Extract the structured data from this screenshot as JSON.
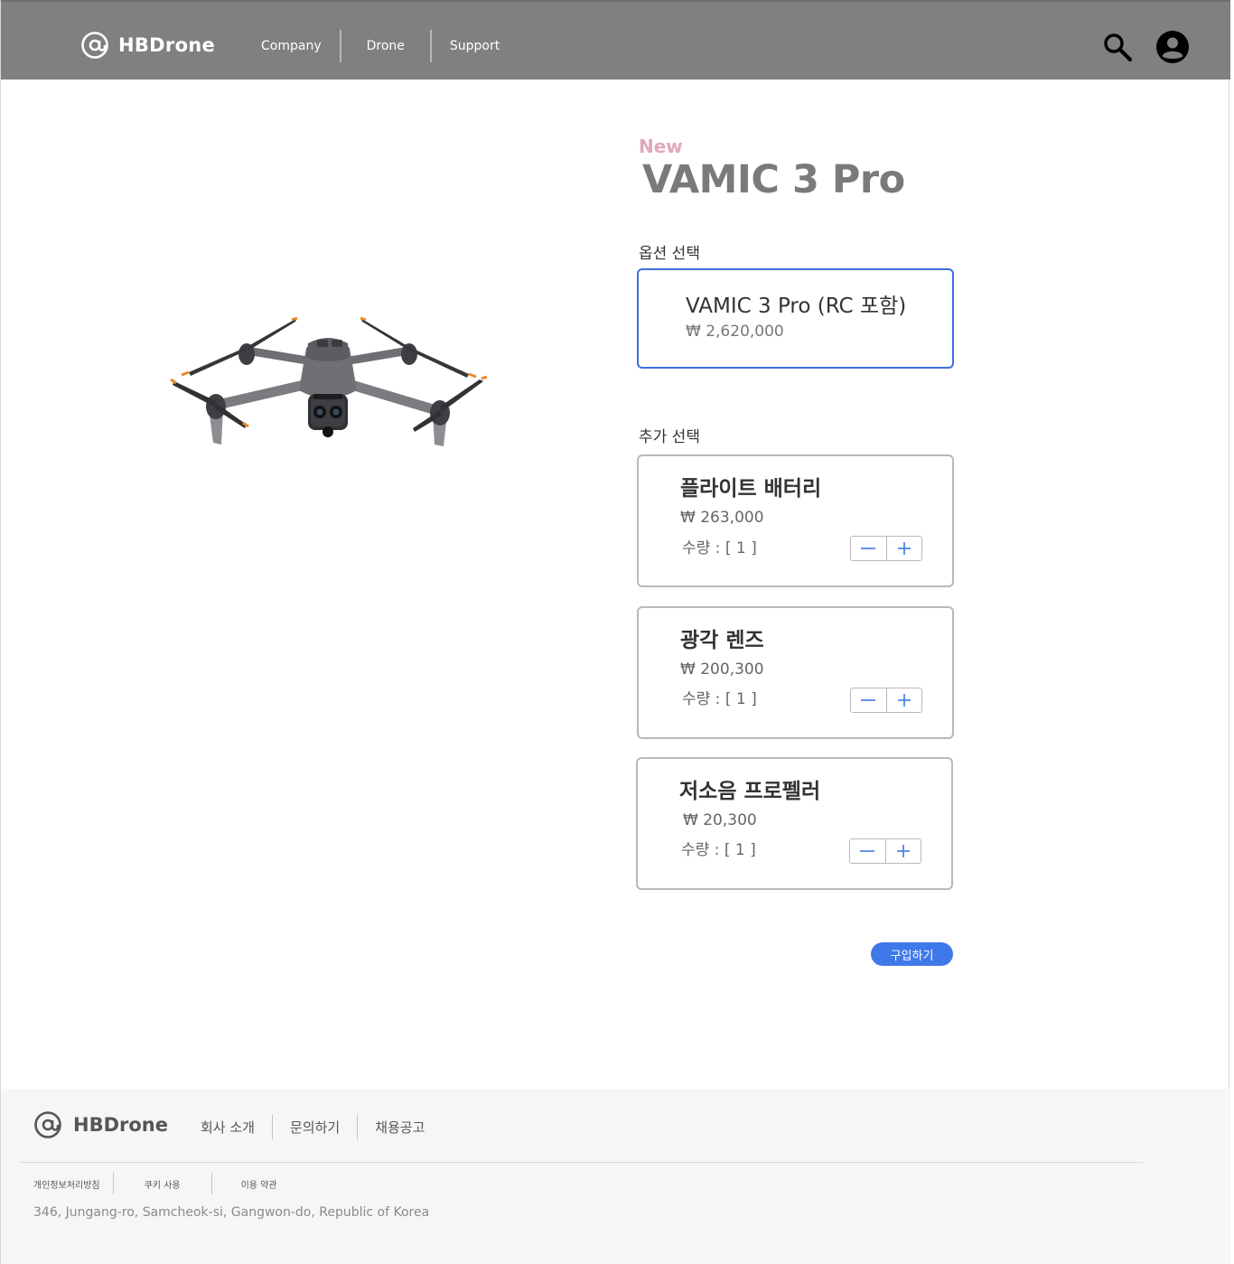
{
  "header": {
    "brand": "HBDrone",
    "nav": [
      "Company",
      "Drone",
      "Support"
    ],
    "icons": [
      "search-icon",
      "user-icon",
      "at-sign-icon"
    ]
  },
  "product": {
    "badge": "New",
    "title": "VAMIC 3 Pro",
    "image_icon": "drone-image"
  },
  "option_section": {
    "label": "옵션 선택",
    "selected": {
      "name": "VAMIC 3 Pro (RC 포함)",
      "price": "₩ 2,620,000"
    }
  },
  "addon_section": {
    "label": "추가 선택",
    "items": [
      {
        "name": "플라이트 배터리",
        "price": "₩ 263,000",
        "qty": "수량 : [ 1 ]",
        "quantity": 1
      },
      {
        "name": "광각 렌즈",
        "price": "₩ 200,300",
        "qty": "수량 : [ 1 ]",
        "quantity": 1
      },
      {
        "name": "저소음 프로펠러",
        "price": "₩ 20,300",
        "qty": "수량 : [ 1 ]",
        "quantity": 1
      }
    ]
  },
  "buy_button": "구입하기",
  "footer": {
    "brand": "HBDrone",
    "nav": [
      "회사 소개",
      "문의하기",
      "채용공고"
    ],
    "links": [
      "개인정보처리방침",
      "쿠키 사용",
      "이용 약관"
    ],
    "address": "346, Jungang-ro, Samcheok-si, Gangwon-do, Republic of Korea"
  },
  "colors": {
    "header_bg": "#808080",
    "accent": "#3f78e8",
    "badge": "#e3a6bd",
    "footer_bg": "#f6f6f6"
  }
}
